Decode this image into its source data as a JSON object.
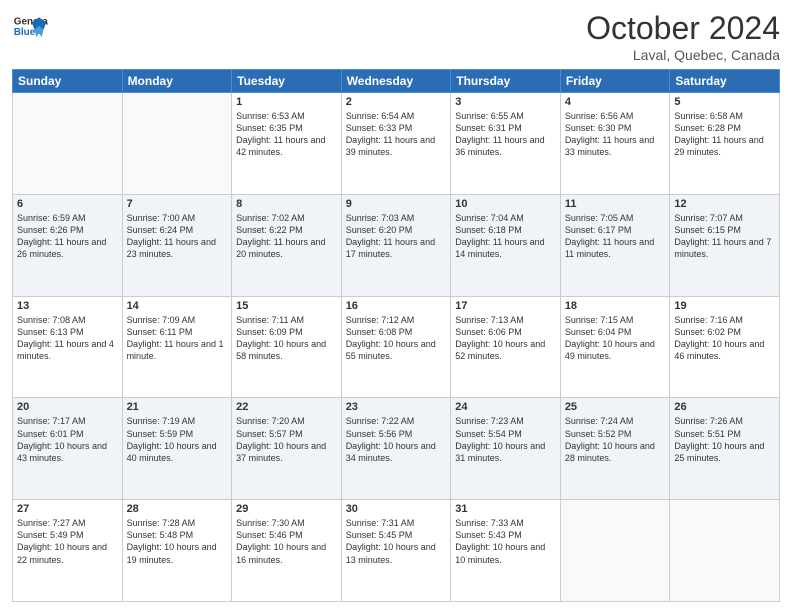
{
  "header": {
    "logo_general": "General",
    "logo_blue": "Blue",
    "month": "October 2024",
    "location": "Laval, Quebec, Canada"
  },
  "days_of_week": [
    "Sunday",
    "Monday",
    "Tuesday",
    "Wednesday",
    "Thursday",
    "Friday",
    "Saturday"
  ],
  "weeks": [
    [
      {
        "day": "",
        "info": ""
      },
      {
        "day": "",
        "info": ""
      },
      {
        "day": "1",
        "info": "Sunrise: 6:53 AM\nSunset: 6:35 PM\nDaylight: 11 hours and 42 minutes."
      },
      {
        "day": "2",
        "info": "Sunrise: 6:54 AM\nSunset: 6:33 PM\nDaylight: 11 hours and 39 minutes."
      },
      {
        "day": "3",
        "info": "Sunrise: 6:55 AM\nSunset: 6:31 PM\nDaylight: 11 hours and 36 minutes."
      },
      {
        "day": "4",
        "info": "Sunrise: 6:56 AM\nSunset: 6:30 PM\nDaylight: 11 hours and 33 minutes."
      },
      {
        "day": "5",
        "info": "Sunrise: 6:58 AM\nSunset: 6:28 PM\nDaylight: 11 hours and 29 minutes."
      }
    ],
    [
      {
        "day": "6",
        "info": "Sunrise: 6:59 AM\nSunset: 6:26 PM\nDaylight: 11 hours and 26 minutes."
      },
      {
        "day": "7",
        "info": "Sunrise: 7:00 AM\nSunset: 6:24 PM\nDaylight: 11 hours and 23 minutes."
      },
      {
        "day": "8",
        "info": "Sunrise: 7:02 AM\nSunset: 6:22 PM\nDaylight: 11 hours and 20 minutes."
      },
      {
        "day": "9",
        "info": "Sunrise: 7:03 AM\nSunset: 6:20 PM\nDaylight: 11 hours and 17 minutes."
      },
      {
        "day": "10",
        "info": "Sunrise: 7:04 AM\nSunset: 6:18 PM\nDaylight: 11 hours and 14 minutes."
      },
      {
        "day": "11",
        "info": "Sunrise: 7:05 AM\nSunset: 6:17 PM\nDaylight: 11 hours and 11 minutes."
      },
      {
        "day": "12",
        "info": "Sunrise: 7:07 AM\nSunset: 6:15 PM\nDaylight: 11 hours and 7 minutes."
      }
    ],
    [
      {
        "day": "13",
        "info": "Sunrise: 7:08 AM\nSunset: 6:13 PM\nDaylight: 11 hours and 4 minutes."
      },
      {
        "day": "14",
        "info": "Sunrise: 7:09 AM\nSunset: 6:11 PM\nDaylight: 11 hours and 1 minute."
      },
      {
        "day": "15",
        "info": "Sunrise: 7:11 AM\nSunset: 6:09 PM\nDaylight: 10 hours and 58 minutes."
      },
      {
        "day": "16",
        "info": "Sunrise: 7:12 AM\nSunset: 6:08 PM\nDaylight: 10 hours and 55 minutes."
      },
      {
        "day": "17",
        "info": "Sunrise: 7:13 AM\nSunset: 6:06 PM\nDaylight: 10 hours and 52 minutes."
      },
      {
        "day": "18",
        "info": "Sunrise: 7:15 AM\nSunset: 6:04 PM\nDaylight: 10 hours and 49 minutes."
      },
      {
        "day": "19",
        "info": "Sunrise: 7:16 AM\nSunset: 6:02 PM\nDaylight: 10 hours and 46 minutes."
      }
    ],
    [
      {
        "day": "20",
        "info": "Sunrise: 7:17 AM\nSunset: 6:01 PM\nDaylight: 10 hours and 43 minutes."
      },
      {
        "day": "21",
        "info": "Sunrise: 7:19 AM\nSunset: 5:59 PM\nDaylight: 10 hours and 40 minutes."
      },
      {
        "day": "22",
        "info": "Sunrise: 7:20 AM\nSunset: 5:57 PM\nDaylight: 10 hours and 37 minutes."
      },
      {
        "day": "23",
        "info": "Sunrise: 7:22 AM\nSunset: 5:56 PM\nDaylight: 10 hours and 34 minutes."
      },
      {
        "day": "24",
        "info": "Sunrise: 7:23 AM\nSunset: 5:54 PM\nDaylight: 10 hours and 31 minutes."
      },
      {
        "day": "25",
        "info": "Sunrise: 7:24 AM\nSunset: 5:52 PM\nDaylight: 10 hours and 28 minutes."
      },
      {
        "day": "26",
        "info": "Sunrise: 7:26 AM\nSunset: 5:51 PM\nDaylight: 10 hours and 25 minutes."
      }
    ],
    [
      {
        "day": "27",
        "info": "Sunrise: 7:27 AM\nSunset: 5:49 PM\nDaylight: 10 hours and 22 minutes."
      },
      {
        "day": "28",
        "info": "Sunrise: 7:28 AM\nSunset: 5:48 PM\nDaylight: 10 hours and 19 minutes."
      },
      {
        "day": "29",
        "info": "Sunrise: 7:30 AM\nSunset: 5:46 PM\nDaylight: 10 hours and 16 minutes."
      },
      {
        "day": "30",
        "info": "Sunrise: 7:31 AM\nSunset: 5:45 PM\nDaylight: 10 hours and 13 minutes."
      },
      {
        "day": "31",
        "info": "Sunrise: 7:33 AM\nSunset: 5:43 PM\nDaylight: 10 hours and 10 minutes."
      },
      {
        "day": "",
        "info": ""
      },
      {
        "day": "",
        "info": ""
      }
    ]
  ]
}
